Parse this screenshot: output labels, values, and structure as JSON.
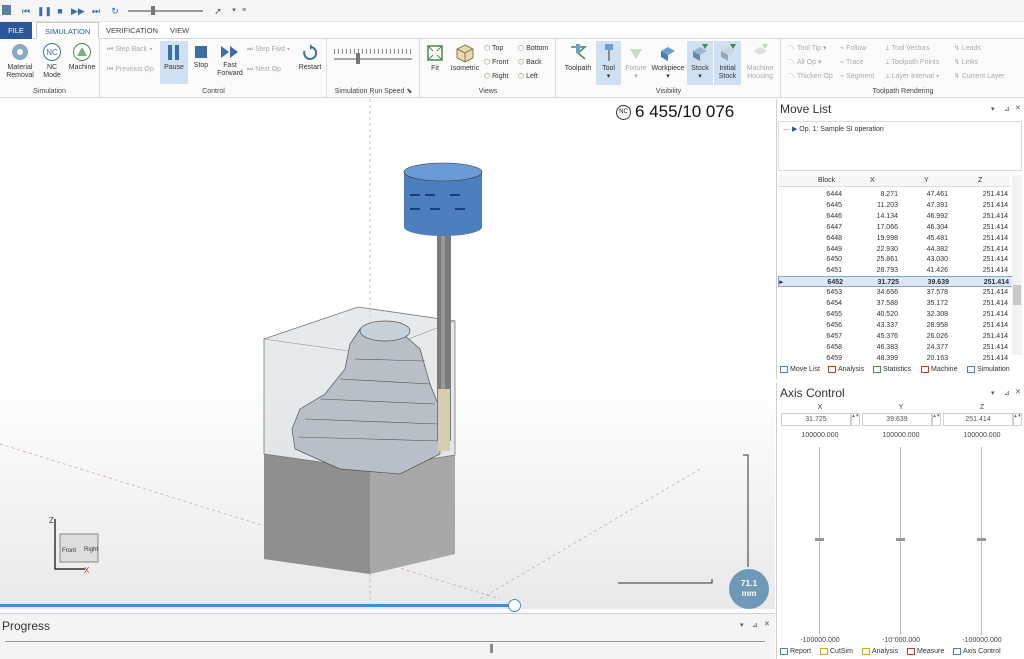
{
  "quick_access": {
    "icons": [
      "save-icon",
      "pause-icon",
      "stop-icon",
      "play-icon",
      "forward-icon",
      "reload-icon",
      "speed-slider",
      "pointer-icon"
    ]
  },
  "tabs": [
    {
      "label": "FILE"
    },
    {
      "label": "SIMULATION"
    },
    {
      "label": "VERIFICATION"
    },
    {
      "label": "VIEW"
    }
  ],
  "ribbon": {
    "simulation": {
      "label": "Simulation",
      "material_removal": "Material Removal",
      "nc_mode": "NC Mode",
      "machine": "Machine"
    },
    "control": {
      "label": "Control",
      "step_back": "Step Back",
      "previous_op": "Previous Op",
      "pause": "Pause",
      "stop": "Stop",
      "fast_forward": "Fast Forward",
      "step_fwd": "Step Fwd",
      "next_op": "Next Op",
      "restart": "Restart"
    },
    "speed": {
      "label": "Simulation Run Speed"
    },
    "views": {
      "label": "Views",
      "fit": "Fit",
      "isometric": "Isometric",
      "top": "Top",
      "front": "Front",
      "right": "Right",
      "bottom": "Bottom",
      "back": "Back",
      "left": "Left"
    },
    "visibility": {
      "label": "Visibility",
      "toolpath": "Toolpath",
      "tool": "Tool",
      "fixture": "Fixture",
      "workpiece": "Workpiece",
      "stock": "Stock",
      "initial_stock": "Initial Stock",
      "machine_housing": "Machine Housing"
    },
    "toolpath_rendering": {
      "label": "Toolpath Rendering",
      "tool_tip": "Tool Tip",
      "all_op": "All Op",
      "thicken_op": "Thicken Op",
      "follow": "Follow",
      "trace": "Trace",
      "segment": "Segment",
      "tool_vectors": "Tool Vectors",
      "toolpath_points": "Toolpath Points",
      "layer_interval": "Layer Interval",
      "leads": "Leads",
      "links": "Links",
      "current_layer": "Current Layer"
    }
  },
  "viewport": {
    "nc_badge": "NC",
    "nc_counter": "6 455/10 076",
    "scale_value": "71.1",
    "scale_unit": "mm",
    "progress_fraction": 0.665,
    "triad": {
      "z": "Z",
      "x": "X",
      "front": "Front",
      "right": "Right"
    }
  },
  "progress": {
    "title": "Progress"
  },
  "move_list": {
    "title": "Move List",
    "operation": "Op. 1: Sample SI operation",
    "columns": [
      "Block",
      "X",
      "Y",
      "Z"
    ],
    "rows": [
      [
        "6444",
        "8.271",
        "47.461",
        "251.414"
      ],
      [
        "6445",
        "11.203",
        "47.391",
        "251.414"
      ],
      [
        "6446",
        "14.134",
        "46.992",
        "251.414"
      ],
      [
        "6447",
        "17.066",
        "46.304",
        "251.414"
      ],
      [
        "6448",
        "19.998",
        "45.481",
        "251.414"
      ],
      [
        "6449",
        "22.930",
        "44.382",
        "251.414"
      ],
      [
        "6450",
        "25.861",
        "43.030",
        "251.414"
      ],
      [
        "6451",
        "28.793",
        "41.426",
        "251.414"
      ],
      [
        "6452",
        "31.725",
        "39.639",
        "251.414"
      ],
      [
        "6453",
        "34.656",
        "37.578",
        "251.414"
      ],
      [
        "6454",
        "37.588",
        "35.172",
        "251.414"
      ],
      [
        "6455",
        "40.520",
        "32.308",
        "251.414"
      ],
      [
        "6456",
        "43.337",
        "28.958",
        "251.414"
      ],
      [
        "6457",
        "45.376",
        "26.026",
        "251.414"
      ],
      [
        "6458",
        "46.383",
        "24.377",
        "251.414"
      ],
      [
        "6459",
        "48.399",
        "20.163",
        "251.414"
      ]
    ],
    "selected_index": 8,
    "tabs": [
      "Move List",
      "Analysis",
      "Statistics",
      "Machine",
      "Simulation"
    ]
  },
  "axis_control": {
    "title": "Axis Control",
    "axes": [
      {
        "name": "X",
        "value": "31.725",
        "max": "100000.000",
        "min": "-100000.000"
      },
      {
        "name": "Y",
        "value": "39.639",
        "max": "100000.000",
        "min": "-10ᵔ000.000"
      },
      {
        "name": "Z",
        "value": "251.414",
        "max": "100000.000",
        "min": "-100000.000"
      }
    ],
    "tabs": [
      "Report",
      "CutSim",
      "Analysis",
      "Measure",
      "Axis Control"
    ]
  }
}
